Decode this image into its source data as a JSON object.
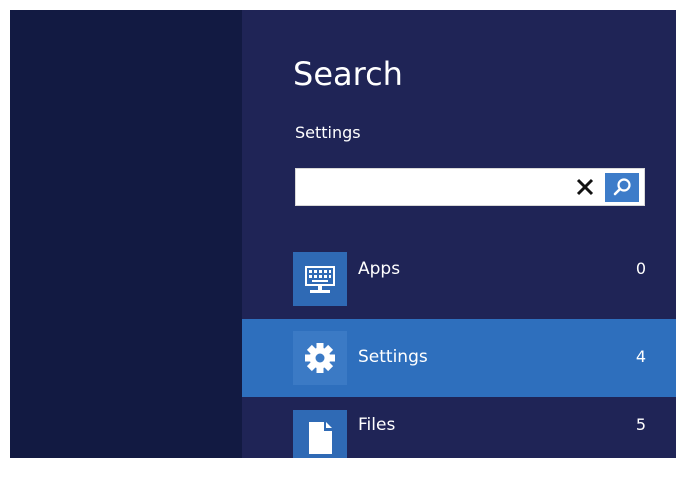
{
  "search": {
    "title": "Search",
    "scope_label": "Settings",
    "query": "",
    "clear_label": "×"
  },
  "results": [
    {
      "label": "Apps",
      "count": "0",
      "icon": "keyboard-monitor-icon",
      "selected": false
    },
    {
      "label": "Settings",
      "count": "4",
      "icon": "gear-icon",
      "selected": true
    },
    {
      "label": "Files",
      "count": "5",
      "icon": "document-icon",
      "selected": false
    }
  ],
  "colors": {
    "left_pane": "#121a42",
    "panel": "#1f2456",
    "selected_row": "#2e6fbd",
    "tile": "#2f6ab5",
    "search_button": "#3d7cc9"
  }
}
